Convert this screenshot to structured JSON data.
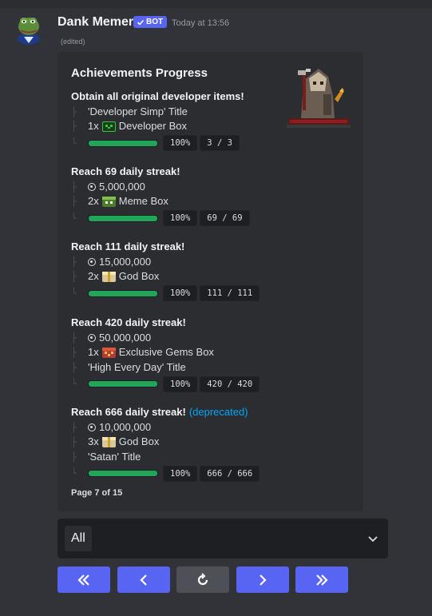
{
  "message": {
    "username": "Dank Memer",
    "bot_badge": "BOT",
    "timestamp": "Today at 13:56",
    "edited_label": "(edited)",
    "avatar_icon": "pepe-frog-avatar"
  },
  "embed": {
    "title": "Achievements Progress",
    "thumbnail_icon": "pixel-hooded-figure-icon",
    "footer": "Page 7 of 15",
    "progress_color": "#23a559",
    "link_color": "#00a8fc",
    "achievements": [
      {
        "name": "Obtain all original developer items!",
        "rewards": [
          {
            "qty": "",
            "icon": "",
            "text": "'Developer Simp' Title"
          },
          {
            "qty": "1x",
            "icon": "developer-box-icon",
            "text": "Developer Box"
          }
        ],
        "progress": 1.0,
        "percent": "100%",
        "count": "3 / 3"
      },
      {
        "name": "Reach 69 daily streak!",
        "rewards": [
          {
            "qty": "",
            "icon": "coin-icon",
            "text": "5,000,000"
          },
          {
            "qty": "2x",
            "icon": "meme-box-icon",
            "text": "Meme Box"
          }
        ],
        "progress": 1.0,
        "percent": "100%",
        "count": "69 / 69"
      },
      {
        "name": "Reach 111 daily streak!",
        "rewards": [
          {
            "qty": "",
            "icon": "coin-icon",
            "text": "15,000,000"
          },
          {
            "qty": "2x",
            "icon": "god-box-icon",
            "text": "God Box"
          }
        ],
        "progress": 1.0,
        "percent": "100%",
        "count": "111 / 111"
      },
      {
        "name": "Reach 420 daily streak!",
        "rewards": [
          {
            "qty": "",
            "icon": "coin-icon",
            "text": "50,000,000"
          },
          {
            "qty": "1x",
            "icon": "exclusive-gems-box-icon",
            "text": "Exclusive Gems Box"
          },
          {
            "qty": "",
            "icon": "",
            "text": "'High Every Day' Title"
          }
        ],
        "progress": 1.0,
        "percent": "100%",
        "count": "420 / 420"
      },
      {
        "name": "Reach 666 daily streak!",
        "tag": "(deprecated)",
        "rewards": [
          {
            "qty": "",
            "icon": "coin-icon",
            "text": "10,000,000"
          },
          {
            "qty": "3x",
            "icon": "god-box-icon",
            "text": "God Box"
          },
          {
            "qty": "",
            "icon": "",
            "text": "'Satan' Title"
          }
        ],
        "progress": 1.0,
        "percent": "100%",
        "count": "666 / 666"
      }
    ]
  },
  "select": {
    "value": "All",
    "chevron_icon": "chevron-down-icon"
  },
  "buttons": [
    {
      "icon": "double-chevron-left-icon",
      "name": "first-page-button"
    },
    {
      "icon": "chevron-left-icon",
      "name": "previous-page-button"
    },
    {
      "icon": "refresh-icon",
      "name": "refresh-button"
    },
    {
      "icon": "chevron-right-icon",
      "name": "next-page-button"
    },
    {
      "icon": "double-chevron-right-icon",
      "name": "last-page-button"
    }
  ]
}
